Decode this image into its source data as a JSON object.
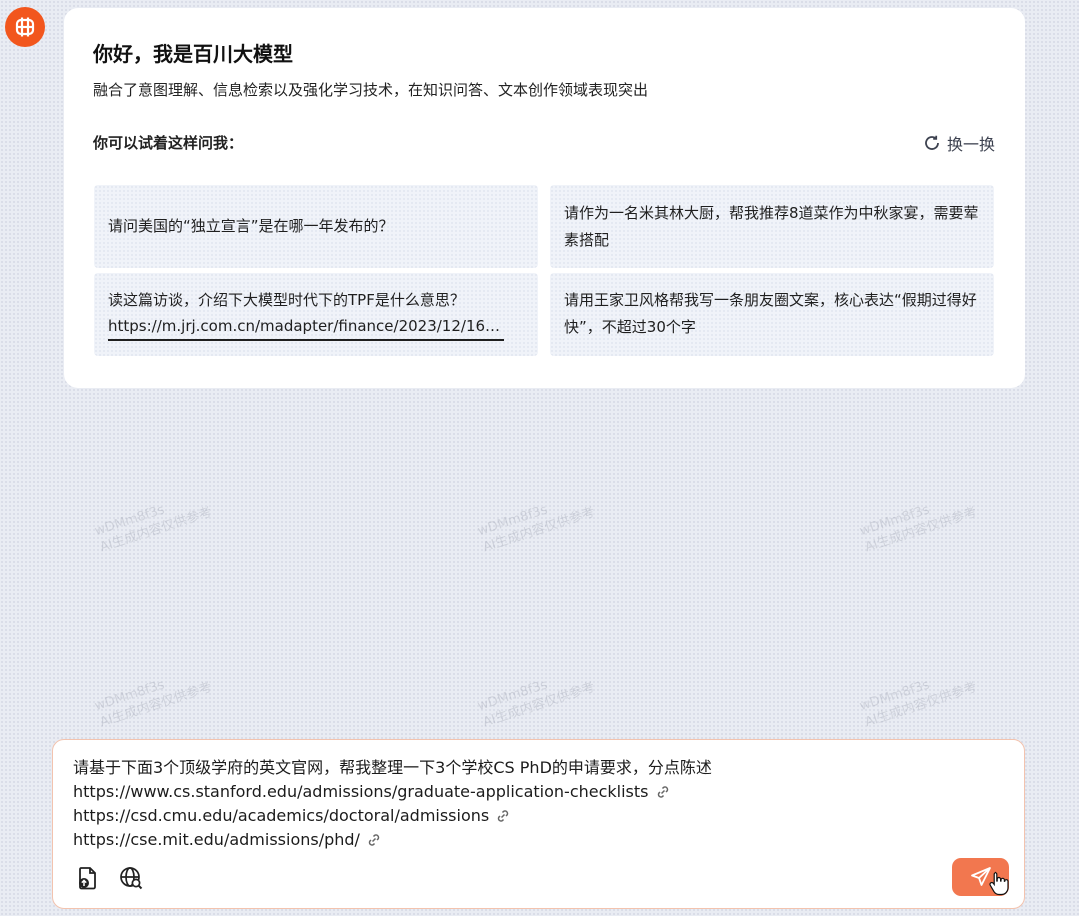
{
  "brand": {
    "logo_icon": "baichuan-logo-icon",
    "accent_color": "#f2561d"
  },
  "welcome": {
    "title": "你好，我是百川大模型",
    "subtitle": "融合了意图理解、信息检索以及强化学习技术，在知识问答、文本创作领域表现突出",
    "try_label": "你可以试着这样问我：",
    "refresh_label": "换一换",
    "refresh_icon": "refresh-icon"
  },
  "suggestions": [
    {
      "text": "请问美国的“独立宣言”是在哪一年发布的？"
    },
    {
      "text": "请作为一名米其林大厨，帮我推荐8道菜作为中秋家宴，需要荤素搭配"
    },
    {
      "text": "读这篇访谈，介绍下大模型时代下的TPF是什么意思？",
      "link": "https://m.jrj.com.cn/madapter/finance/2023/12/162..."
    },
    {
      "text": "请用王家卫风格帮我写一条朋友圈文案，核心表达“假期过得好快”，不超过30个字"
    }
  ],
  "input": {
    "line1": "请基于下面3个顶级学府的英文官网，帮我整理一下3个学校CS PhD的申请要求，分点陈述",
    "urls": [
      "https://www.cs.stanford.edu/admissions/graduate-application-checklists",
      "https://csd.cmu.edu/academics/doctoral/admissions",
      "https://cse.mit.edu/admissions/phd/"
    ],
    "link_icon": "link-icon",
    "upload_icon": "file-upload-icon",
    "websearch_icon": "web-search-icon",
    "send_icon": "send-icon",
    "send_color": "#f2774f"
  },
  "watermark": {
    "line1": "wDMm8f3s",
    "line2": "AI生成内容仅供参考"
  }
}
